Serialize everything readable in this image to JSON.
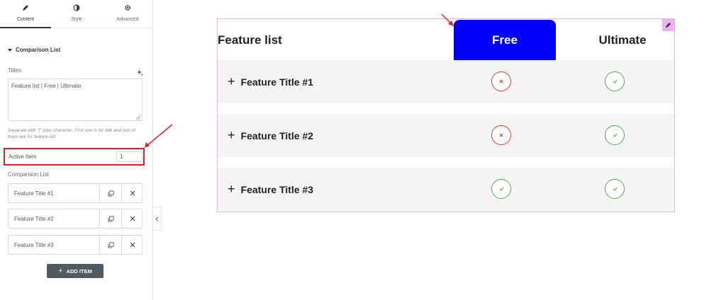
{
  "panel": {
    "tabs": [
      {
        "label": "Content",
        "icon": "pencil-icon",
        "active": true
      },
      {
        "label": "Style",
        "icon": "contrast-icon",
        "active": false
      },
      {
        "label": "Advanced",
        "icon": "gear-icon",
        "active": false
      }
    ],
    "section_title": "Comparison List",
    "titles_label": "Titles",
    "titles_value": "Feature list | Free | Ultimate",
    "titles_hint": "Separate with \"|\" pipe character. First one is for title and rest of them are for feature list.",
    "active_item_label": "Active Item",
    "active_item_value": "1",
    "comparison_list_label": "Comparison List",
    "items": [
      "Feature Title #1",
      "Feature Title #2",
      "Feature Title #3"
    ],
    "add_item_label": "ADD ITEM"
  },
  "table": {
    "title": "Feature list",
    "columns": [
      "Free",
      "Ultimate"
    ],
    "active_column_color": "#0000ff",
    "rows": [
      {
        "title": "Feature Title #1",
        "free": "cross",
        "ultimate": "check"
      },
      {
        "title": "Feature Title #2",
        "free": "cross",
        "ultimate": "check"
      },
      {
        "title": "Feature Title #3",
        "free": "check",
        "ultimate": "check"
      }
    ]
  },
  "colors": {
    "highlight": "#e21f26",
    "cross": "#e53935",
    "check": "#4caf50",
    "widget_outline": "#e7b4f1"
  }
}
